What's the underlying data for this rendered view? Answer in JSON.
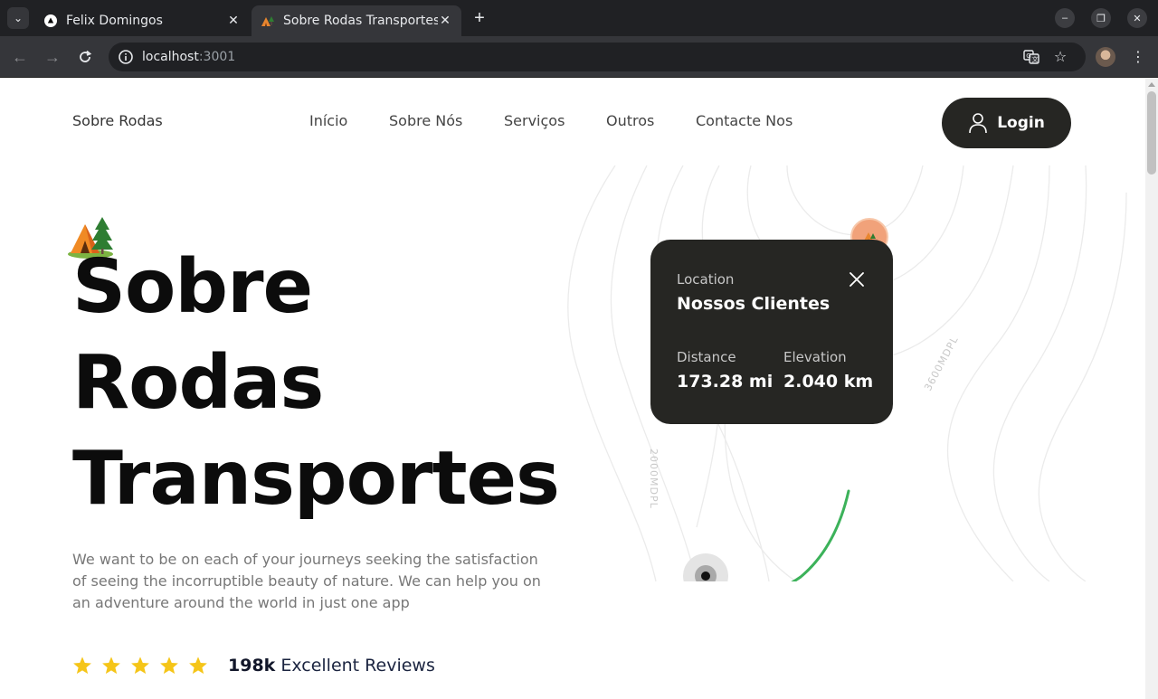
{
  "browser": {
    "tabs": [
      {
        "title": "Felix Domingos",
        "active": false
      },
      {
        "title": "Sobre Rodas Transportes",
        "active": true
      }
    ],
    "url_host": "localhost",
    "url_port": ":3001"
  },
  "header": {
    "brand": "Sobre Rodas",
    "nav": [
      "Início",
      "Sobre Nós",
      "Serviços",
      "Outros",
      "Contacte Nos"
    ],
    "login_label": "Login"
  },
  "hero": {
    "title_lines": [
      "Sobre",
      "Rodas",
      "Transportes"
    ],
    "description": "We want to be on each of your journeys seeking the satisfaction of seeing the incorruptible beauty of nature. We can help you on an adventure around the world in just one app",
    "rating_stars": 5,
    "reviews_count": "198k",
    "reviews_label": "Excellent Reviews"
  },
  "map": {
    "contour_labels": [
      "3600MDPL",
      "2000MDPL"
    ],
    "card": {
      "location_label": "Location",
      "location_name": "Nossos Clientes",
      "distance_label": "Distance",
      "distance_value": "173.28 mi",
      "elevation_label": "Elevation",
      "elevation_value": "2.040 km"
    },
    "route_color": "#3cb25a"
  },
  "colors": {
    "dark": "#262623",
    "star": "#f5c518",
    "pin": "#f1a27a"
  }
}
